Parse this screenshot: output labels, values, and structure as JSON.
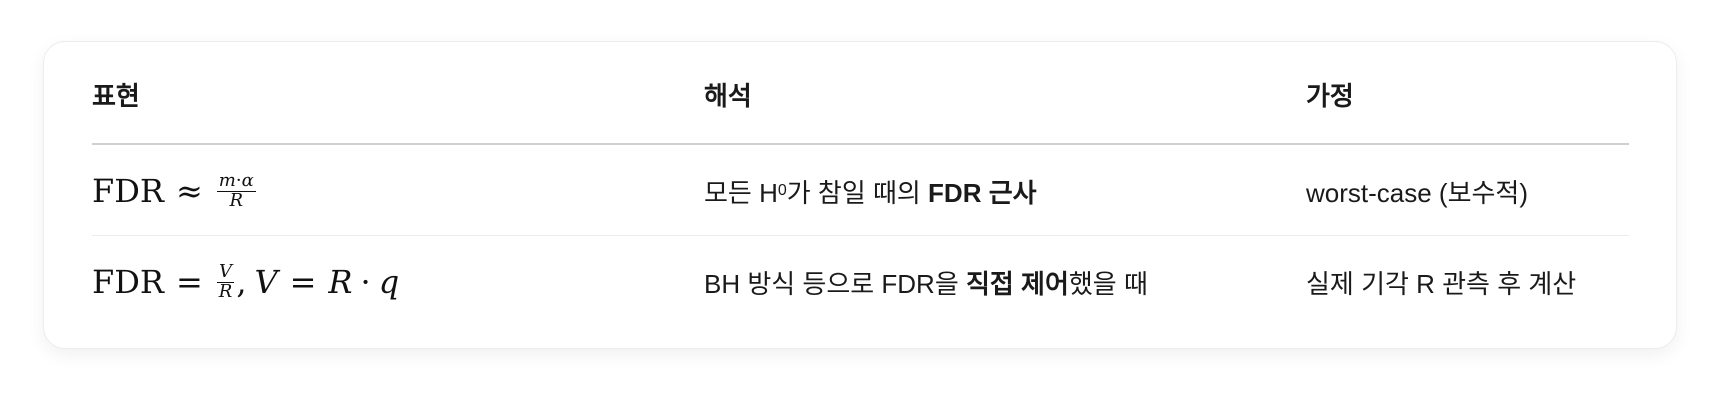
{
  "table": {
    "headers": [
      "표현",
      "해석",
      "가정"
    ],
    "rows": [
      {
        "formula": {
          "lhs": "FDR",
          "op": "≈",
          "num_m": "m",
          "num_dot": "·",
          "num_alpha": "α",
          "den": "R"
        },
        "interp": {
          "pre": "모든 H",
          "sub": "0",
          "mid": "가 참일 때의 ",
          "bold": "FDR 근사"
        },
        "assumption": "worst-case (보수적)"
      },
      {
        "formula": {
          "lhs": "FDR",
          "op": "=",
          "num": "V",
          "den": "R",
          "comma": ",",
          "v": "V",
          "eq": "=",
          "r": "R",
          "dot": "·",
          "q": "q"
        },
        "interp": {
          "pre": "BH 방식 등으로 FDR을 ",
          "bold": "직접 제어",
          "post": "했을 때"
        },
        "assumption": "실제 기각 R 관측 후 계산"
      }
    ]
  }
}
